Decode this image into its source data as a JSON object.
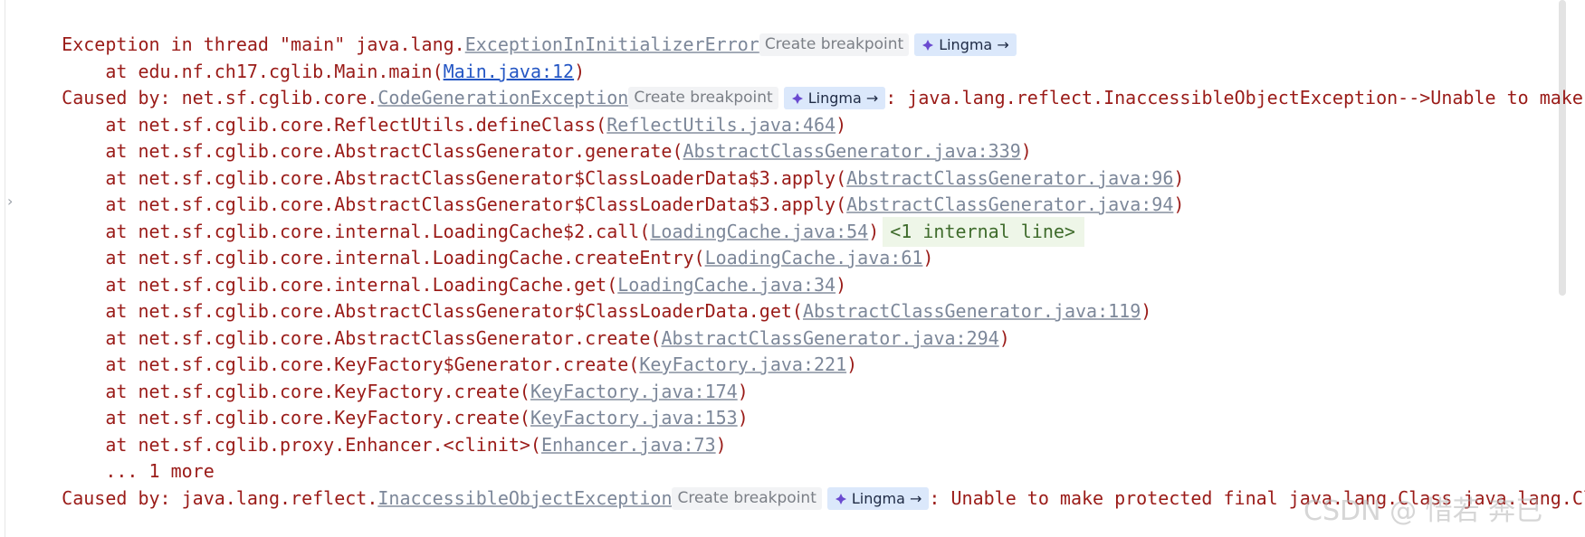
{
  "console": {
    "lines": [
      {
        "pre": "Exception in thread \"main\" java.lang.",
        "link": "ExceptionInInitializerError",
        "post": ""
      },
      {
        "pre": "    at edu.nf.ch17.cglib.Main.main(",
        "link": "Main.java:12",
        "post": ")"
      },
      {
        "pre": "Caused by: net.sf.cglib.core.",
        "link": "CodeGenerationException",
        "post": ": java.lang.reflect.InaccessibleObjectException-->Unable to make protected"
      },
      {
        "pre": "    at net.sf.cglib.core.ReflectUtils.defineClass(",
        "link": "ReflectUtils.java:464",
        "post": ")"
      },
      {
        "pre": "    at net.sf.cglib.core.AbstractClassGenerator.generate(",
        "link": "AbstractClassGenerator.java:339",
        "post": ")"
      },
      {
        "pre": "    at net.sf.cglib.core.AbstractClassGenerator$ClassLoaderData$3.apply(",
        "link": "AbstractClassGenerator.java:96",
        "post": ")"
      },
      {
        "pre": "    at net.sf.cglib.core.AbstractClassGenerator$ClassLoaderData$3.apply(",
        "link": "AbstractClassGenerator.java:94",
        "post": ")"
      },
      {
        "pre": "    at net.sf.cglib.core.internal.LoadingCache$2.call(",
        "link": "LoadingCache.java:54",
        "post": ")"
      },
      {
        "pre": "    at net.sf.cglib.core.internal.LoadingCache.createEntry(",
        "link": "LoadingCache.java:61",
        "post": ")"
      },
      {
        "pre": "    at net.sf.cglib.core.internal.LoadingCache.get(",
        "link": "LoadingCache.java:34",
        "post": ")"
      },
      {
        "pre": "    at net.sf.cglib.core.AbstractClassGenerator$ClassLoaderData.get(",
        "link": "AbstractClassGenerator.java:119",
        "post": ")"
      },
      {
        "pre": "    at net.sf.cglib.core.AbstractClassGenerator.create(",
        "link": "AbstractClassGenerator.java:294",
        "post": ")"
      },
      {
        "pre": "    at net.sf.cglib.core.KeyFactory$Generator.create(",
        "link": "KeyFactory.java:221",
        "post": ")"
      },
      {
        "pre": "    at net.sf.cglib.core.KeyFactory.create(",
        "link": "KeyFactory.java:174",
        "post": ")"
      },
      {
        "pre": "    at net.sf.cglib.core.KeyFactory.create(",
        "link": "KeyFactory.java:153",
        "post": ")"
      },
      {
        "pre": "    at net.sf.cglib.proxy.Enhancer.<clinit>(",
        "link": "Enhancer.java:73",
        "post": ")"
      },
      {
        "pre": "    ... 1 more",
        "link": "",
        "post": ""
      },
      {
        "pre": "Caused by: java.lang.reflect.",
        "link": "InaccessibleObjectException",
        "post": ": Unable to make protected final java.lang.Class java.lang.Class"
      }
    ],
    "create_breakpoint_label": "Create breakpoint",
    "lingma_label": "Lingma →",
    "internal_line_label": "<1 internal line>",
    "expand_glyph": "›",
    "watermark": "CSDN @ 惜若 奔已"
  },
  "colors": {
    "error_text": "#9a1b18",
    "link": "#7c8799",
    "link_blue": "#2456c4",
    "lingma_chip_bg": "#dbe8fb",
    "breakpoint_chip_bg": "#f2f3f5",
    "internal_bg": "#eef6e8"
  }
}
